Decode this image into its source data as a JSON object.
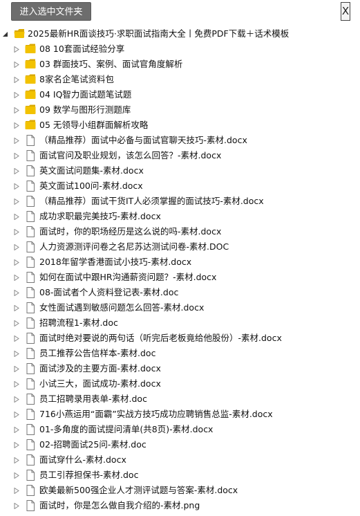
{
  "toolbar": {
    "enter_label": "进入选中文件夹",
    "close_label": "X"
  },
  "tree": {
    "root": {
      "label": "2025最新HR面谈技巧·求职面试指南大全丨免费PDF下载＋话术模板",
      "icon": "folder-open-icon"
    },
    "children": [
      {
        "label": "08 10套面试经验分享",
        "type": "folder"
      },
      {
        "label": "03 群面技巧、案例、面试官角度解析",
        "type": "folder"
      },
      {
        "label": "8家名企笔试资料包",
        "type": "folder"
      },
      {
        "label": "04 IQ智力面试题笔试题",
        "type": "folder"
      },
      {
        "label": "09 数学与图形行测题库",
        "type": "folder"
      },
      {
        "label": "05 无领导小组群面解析攻略",
        "type": "folder"
      },
      {
        "label": "（精品推荐）面试中必备与面试官聊天技巧-素材.docx",
        "type": "file"
      },
      {
        "label": "面试官问及职业规划，该怎么回答？-素材.docx",
        "type": "file"
      },
      {
        "label": "英文面试问题集-素材.docx",
        "type": "file"
      },
      {
        "label": "英文面试100问-素材.docx",
        "type": "file"
      },
      {
        "label": "（精品推荐）面试干货IT人必须掌握的面试技巧-素材.docx",
        "type": "file"
      },
      {
        "label": "成功求职最完美技巧-素材.docx",
        "type": "file"
      },
      {
        "label": "面试时，你的职场经历是这么说的吗-素材.docx",
        "type": "file"
      },
      {
        "label": "人力资源测评问卷之名尼苏达测试问卷-素材.DOC",
        "type": "file"
      },
      {
        "label": "2018年留学香港面试小技巧-素材.docx",
        "type": "file"
      },
      {
        "label": "如何在面试中跟HR沟通薪资问题？-素材.docx",
        "type": "file"
      },
      {
        "label": "08-面试者个人资料登记表-素材.doc",
        "type": "file"
      },
      {
        "label": "女性面试遇到敏感问题怎么回答-素材.docx",
        "type": "file"
      },
      {
        "label": "招聘流程1-素材.doc",
        "type": "file"
      },
      {
        "label": "面试时绝对要说的两句话（听完后老板竟给他股份）-素材.docx",
        "type": "file"
      },
      {
        "label": "员工推荐公告信样本-素材.doc",
        "type": "file"
      },
      {
        "label": "面试涉及的主要方面-素材.docx",
        "type": "file"
      },
      {
        "label": "小试三大，面试成功-素材.docx",
        "type": "file"
      },
      {
        "label": "员工招聘录用表单-素材.doc",
        "type": "file"
      },
      {
        "label": "716小燕运用“面霸”实战方技巧成功应聘销售总监-素材.docx",
        "type": "file"
      },
      {
        "label": "01-多角度的面试提问清单(共8页)-素材.docx",
        "type": "file"
      },
      {
        "label": "02-招聘面试25问-素材.doc",
        "type": "file"
      },
      {
        "label": "面试穿什么-素材.docx",
        "type": "file"
      },
      {
        "label": "员工引荐担保书-素材.doc",
        "type": "file"
      },
      {
        "label": "欧美最新500强企业人才测评试题与答案-素材.docx",
        "type": "file"
      },
      {
        "label": "面试时，你是怎么做自我介绍的-素材.png",
        "type": "file"
      }
    ]
  },
  "colors": {
    "folder": "#f2c200",
    "folder_dark": "#d9a800",
    "button_bg": "#6d6d6d"
  }
}
